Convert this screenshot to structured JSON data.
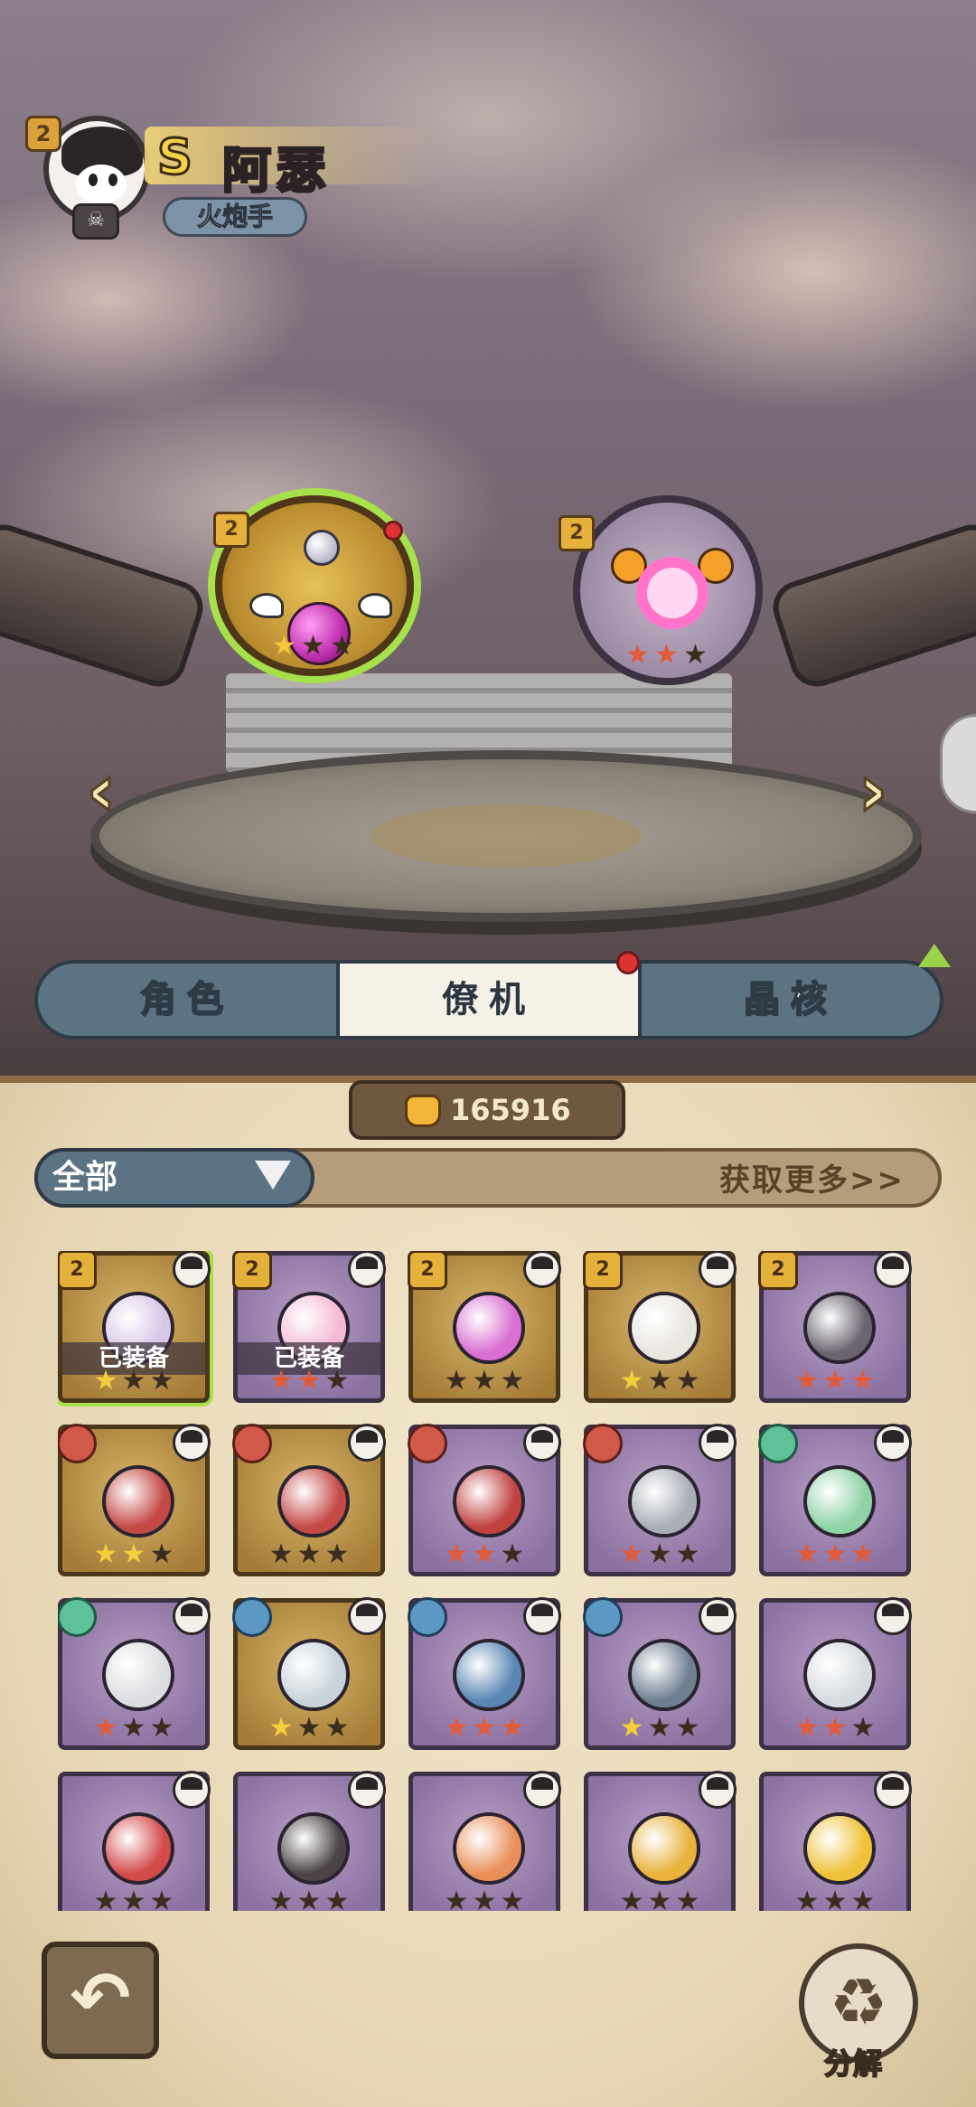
{
  "hero": {
    "rank": "S",
    "name": "阿瑟",
    "class": "火炮手",
    "level_badge": "2"
  },
  "slots": {
    "left_badge": "2",
    "right_badge": "2"
  },
  "nav": {
    "prev": "‹",
    "next": "›"
  },
  "tabs": [
    {
      "label": "角色"
    },
    {
      "label": "僚机"
    },
    {
      "label": "晶核"
    }
  ],
  "currency": {
    "amount": "165916"
  },
  "filter": {
    "selected": "全部",
    "get_more": "获取更多>>"
  },
  "equipped_label": "已装备",
  "items": [
    {
      "badge": "2",
      "badge_type": "gold",
      "frame": "gold",
      "equipped": true,
      "stars": [
        1,
        0,
        0
      ],
      "color": "#d9c6e8"
    },
    {
      "badge": "2",
      "badge_type": "gold",
      "frame": "purple",
      "equipped": true,
      "stars": [
        2,
        2,
        0
      ],
      "color": "#f5b9d6"
    },
    {
      "badge": "2",
      "badge_type": "gold",
      "frame": "gold",
      "equipped": false,
      "stars": [
        0,
        0,
        0
      ],
      "color": "#d86fd1"
    },
    {
      "badge": "2",
      "badge_type": "gold",
      "frame": "gold",
      "equipped": false,
      "stars": [
        1,
        0,
        0
      ],
      "color": "#e9e5df"
    },
    {
      "badge": "2",
      "badge_type": "gold",
      "frame": "purple",
      "equipped": false,
      "stars": [
        2,
        2,
        2
      ],
      "color": "#6b6470"
    },
    {
      "badge": "",
      "badge_type": "red",
      "frame": "gold",
      "equipped": false,
      "stars": [
        1,
        1,
        0
      ],
      "color": "#c44a46"
    },
    {
      "badge": "",
      "badge_type": "red",
      "frame": "gold",
      "equipped": false,
      "stars": [
        0,
        0,
        0
      ],
      "color": "#c44a46"
    },
    {
      "badge": "",
      "badge_type": "red",
      "frame": "purple",
      "equipped": false,
      "stars": [
        2,
        2,
        0
      ],
      "color": "#c0423f"
    },
    {
      "badge": "",
      "badge_type": "red",
      "frame": "purple",
      "equipped": false,
      "stars": [
        2,
        0,
        0
      ],
      "color": "#a9aeb6"
    },
    {
      "badge": "",
      "badge_type": "green",
      "frame": "purple",
      "equipped": false,
      "stars": [
        2,
        2,
        2
      ],
      "color": "#8fd3a6"
    },
    {
      "badge": "",
      "badge_type": "green",
      "frame": "purple",
      "equipped": false,
      "stars": [
        2,
        0,
        0
      ],
      "color": "#dcdde0"
    },
    {
      "badge": "",
      "badge_type": "blue",
      "frame": "gold",
      "equipped": false,
      "stars": [
        1,
        0,
        0
      ],
      "color": "#c9d3da"
    },
    {
      "badge": "",
      "badge_type": "blue",
      "frame": "purple",
      "equipped": false,
      "stars": [
        2,
        2,
        2
      ],
      "color": "#5a86b4"
    },
    {
      "badge": "",
      "badge_type": "blue",
      "frame": "purple",
      "equipped": false,
      "stars": [
        1,
        0,
        0
      ],
      "color": "#6e7f91"
    },
    {
      "badge": "",
      "badge_type": "none",
      "frame": "purple",
      "equipped": false,
      "stars": [
        2,
        2,
        0
      ],
      "color": "#d6dbe0"
    },
    {
      "badge": "",
      "badge_type": "none",
      "frame": "purple",
      "equipped": false,
      "stars": [
        0,
        0,
        0
      ],
      "color": "#d34a4a"
    },
    {
      "badge": "",
      "badge_type": "none",
      "frame": "purple",
      "equipped": false,
      "stars": [
        0,
        0,
        0
      ],
      "color": "#4b4346"
    },
    {
      "badge": "",
      "badge_type": "none",
      "frame": "purple",
      "equipped": false,
      "stars": [
        0,
        0,
        0
      ],
      "color": "#e9905a"
    },
    {
      "badge": "",
      "badge_type": "none",
      "frame": "purple",
      "equipped": false,
      "stars": [
        0,
        0,
        0
      ],
      "color": "#e8b23b"
    },
    {
      "badge": "",
      "badge_type": "none",
      "frame": "purple",
      "equipped": false,
      "stars": [
        0,
        0,
        0
      ],
      "color": "#efc23a"
    }
  ],
  "actions": {
    "back": "↶",
    "recycle_icon": "♻",
    "recycle_label": "分解"
  }
}
